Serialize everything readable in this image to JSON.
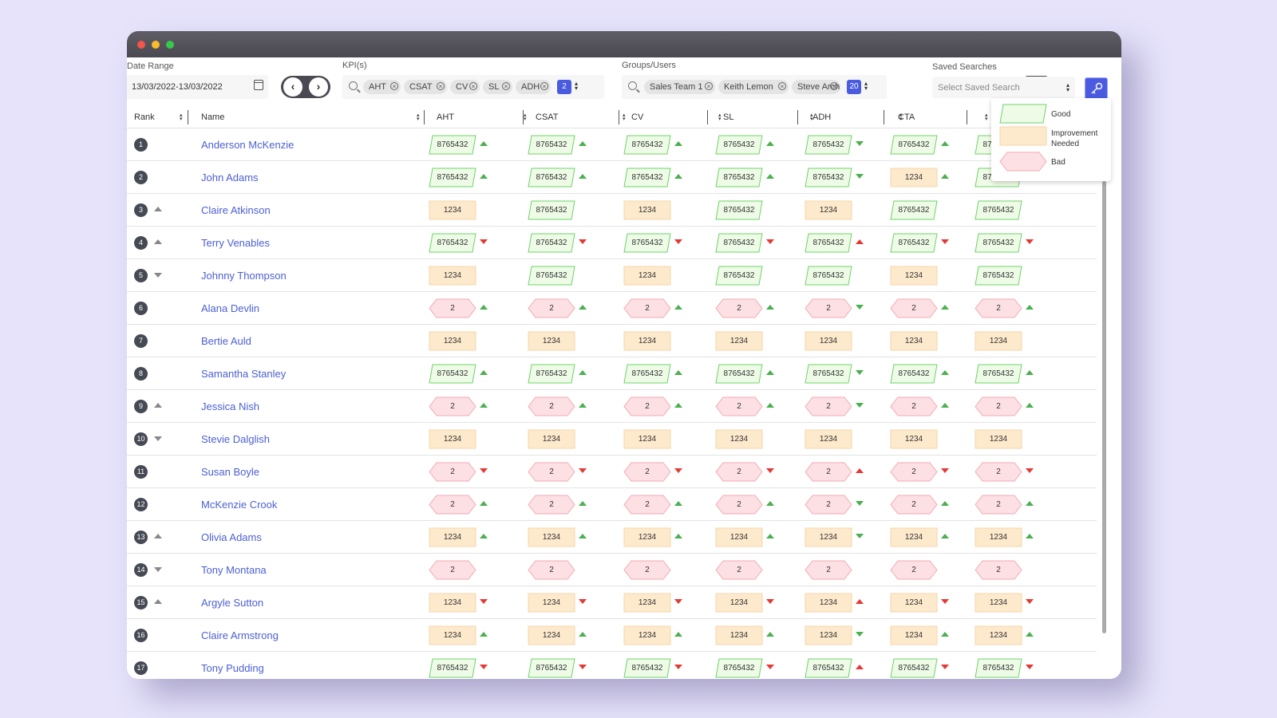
{
  "filters": {
    "date_range": {
      "label": "Date Range",
      "value": "13/03/2022-13/03/2022"
    },
    "kpis": {
      "label": "KPI(s)",
      "chips": [
        "AHT",
        "CSAT",
        "CV",
        "SL",
        "ADH"
      ],
      "count": "2"
    },
    "groups": {
      "label": "Groups/Users",
      "chips": [
        "Sales Team 1",
        "Keith Lemon",
        "Steve Arch"
      ],
      "count": "20"
    },
    "saved": {
      "label": "Saved Searches",
      "placeholder": "Select Saved Search"
    }
  },
  "table": {
    "headers": {
      "rank": "Rank",
      "name": "Name",
      "kpis": [
        "AHT",
        "CSAT",
        "CV",
        "SL",
        "ADH",
        "CTA",
        ""
      ]
    },
    "rows": [
      {
        "rank": "1",
        "rank_trend": "none",
        "name": "Anderson McKenzie",
        "cells": [
          [
            "g",
            "8765432",
            "up"
          ],
          [
            "g",
            "8765432",
            "up"
          ],
          [
            "g",
            "8765432",
            "up"
          ],
          [
            "g",
            "8765432",
            "up"
          ],
          [
            "g",
            "8765432",
            "downg"
          ],
          [
            "g",
            "8765432",
            "up"
          ],
          [
            "g",
            "8765432",
            "none"
          ]
        ]
      },
      {
        "rank": "2",
        "rank_trend": "none",
        "name": "John Adams",
        "cells": [
          [
            "g",
            "8765432",
            "up"
          ],
          [
            "g",
            "8765432",
            "up"
          ],
          [
            "g",
            "8765432",
            "up"
          ],
          [
            "g",
            "8765432",
            "up"
          ],
          [
            "g",
            "8765432",
            "downg"
          ],
          [
            "o",
            "1234",
            "up"
          ],
          [
            "g",
            "8765432",
            "none"
          ]
        ]
      },
      {
        "rank": "3",
        "rank_trend": "up",
        "name": "Claire Atkinson",
        "cells": [
          [
            "o",
            "1234",
            "none"
          ],
          [
            "g",
            "8765432",
            "none"
          ],
          [
            "o",
            "1234",
            "none"
          ],
          [
            "g",
            "8765432",
            "none"
          ],
          [
            "o",
            "1234",
            "none"
          ],
          [
            "g",
            "8765432",
            "none"
          ],
          [
            "g",
            "8765432",
            "none"
          ]
        ]
      },
      {
        "rank": "4",
        "rank_trend": "up",
        "name": "Terry Venables",
        "cells": [
          [
            "g",
            "8765432",
            "down"
          ],
          [
            "g",
            "8765432",
            "down"
          ],
          [
            "g",
            "8765432",
            "down"
          ],
          [
            "g",
            "8765432",
            "down"
          ],
          [
            "g",
            "8765432",
            "upr"
          ],
          [
            "g",
            "8765432",
            "down"
          ],
          [
            "g",
            "8765432",
            "down"
          ]
        ]
      },
      {
        "rank": "5",
        "rank_trend": "down",
        "name": "Johnny Thompson",
        "cells": [
          [
            "o",
            "1234",
            "none"
          ],
          [
            "g",
            "8765432",
            "none"
          ],
          [
            "o",
            "1234",
            "none"
          ],
          [
            "g",
            "8765432",
            "none"
          ],
          [
            "g",
            "8765432",
            "none"
          ],
          [
            "o",
            "1234",
            "none"
          ],
          [
            "g",
            "8765432",
            "none"
          ]
        ]
      },
      {
        "rank": "6",
        "rank_trend": "none",
        "name": "Alana Devlin",
        "cells": [
          [
            "r",
            "2",
            "up"
          ],
          [
            "r",
            "2",
            "up"
          ],
          [
            "r",
            "2",
            "up"
          ],
          [
            "r",
            "2",
            "up"
          ],
          [
            "r",
            "2",
            "downg"
          ],
          [
            "r",
            "2",
            "up"
          ],
          [
            "r",
            "2",
            "up"
          ]
        ]
      },
      {
        "rank": "7",
        "rank_trend": "none",
        "name": "Bertie Auld",
        "cells": [
          [
            "o",
            "1234",
            "none"
          ],
          [
            "o",
            "1234",
            "none"
          ],
          [
            "o",
            "1234",
            "none"
          ],
          [
            "o",
            "1234",
            "none"
          ],
          [
            "o",
            "1234",
            "none"
          ],
          [
            "o",
            "1234",
            "none"
          ],
          [
            "o",
            "1234",
            "none"
          ]
        ]
      },
      {
        "rank": "8",
        "rank_trend": "none",
        "name": "Samantha Stanley",
        "cells": [
          [
            "g",
            "8765432",
            "up"
          ],
          [
            "g",
            "8765432",
            "up"
          ],
          [
            "g",
            "8765432",
            "up"
          ],
          [
            "g",
            "8765432",
            "up"
          ],
          [
            "g",
            "8765432",
            "downg"
          ],
          [
            "g",
            "8765432",
            "up"
          ],
          [
            "g",
            "8765432",
            "up"
          ]
        ]
      },
      {
        "rank": "9",
        "rank_trend": "up",
        "name": "Jessica Nish",
        "cells": [
          [
            "r",
            "2",
            "up"
          ],
          [
            "r",
            "2",
            "up"
          ],
          [
            "r",
            "2",
            "up"
          ],
          [
            "r",
            "2",
            "up"
          ],
          [
            "r",
            "2",
            "downg"
          ],
          [
            "r",
            "2",
            "up"
          ],
          [
            "r",
            "2",
            "up"
          ]
        ]
      },
      {
        "rank": "10",
        "rank_trend": "down",
        "name": "Stevie Dalglish",
        "cells": [
          [
            "o",
            "1234",
            "none"
          ],
          [
            "o",
            "1234",
            "none"
          ],
          [
            "o",
            "1234",
            "none"
          ],
          [
            "o",
            "1234",
            "none"
          ],
          [
            "o",
            "1234",
            "none"
          ],
          [
            "o",
            "1234",
            "none"
          ],
          [
            "o",
            "1234",
            "none"
          ]
        ]
      },
      {
        "rank": "11",
        "rank_trend": "none",
        "name": "Susan Boyle",
        "cells": [
          [
            "r",
            "2",
            "down"
          ],
          [
            "r",
            "2",
            "down"
          ],
          [
            "r",
            "2",
            "down"
          ],
          [
            "r",
            "2",
            "down"
          ],
          [
            "r",
            "2",
            "upr"
          ],
          [
            "r",
            "2",
            "down"
          ],
          [
            "r",
            "2",
            "down"
          ]
        ]
      },
      {
        "rank": "12",
        "rank_trend": "none",
        "name": "McKenzie Crook",
        "cells": [
          [
            "r",
            "2",
            "up"
          ],
          [
            "r",
            "2",
            "up"
          ],
          [
            "r",
            "2",
            "up"
          ],
          [
            "r",
            "2",
            "up"
          ],
          [
            "r",
            "2",
            "downg"
          ],
          [
            "r",
            "2",
            "up"
          ],
          [
            "r",
            "2",
            "up"
          ]
        ]
      },
      {
        "rank": "13",
        "rank_trend": "up",
        "name": "Olivia Adams",
        "cells": [
          [
            "o",
            "1234",
            "up"
          ],
          [
            "o",
            "1234",
            "up"
          ],
          [
            "o",
            "1234",
            "up"
          ],
          [
            "o",
            "1234",
            "up"
          ],
          [
            "o",
            "1234",
            "downg"
          ],
          [
            "o",
            "1234",
            "up"
          ],
          [
            "o",
            "1234",
            "up"
          ]
        ]
      },
      {
        "rank": "14",
        "rank_trend": "down",
        "name": "Tony Montana",
        "cells": [
          [
            "r",
            "2",
            "none"
          ],
          [
            "r",
            "2",
            "none"
          ],
          [
            "r",
            "2",
            "none"
          ],
          [
            "r",
            "2",
            "none"
          ],
          [
            "r",
            "2",
            "none"
          ],
          [
            "r",
            "2",
            "none"
          ],
          [
            "r",
            "2",
            "none"
          ]
        ]
      },
      {
        "rank": "15",
        "rank_trend": "up",
        "name": "Argyle Sutton",
        "cells": [
          [
            "o",
            "1234",
            "down"
          ],
          [
            "o",
            "1234",
            "down"
          ],
          [
            "o",
            "1234",
            "down"
          ],
          [
            "o",
            "1234",
            "down"
          ],
          [
            "o",
            "1234",
            "upr"
          ],
          [
            "o",
            "1234",
            "down"
          ],
          [
            "o",
            "1234",
            "down"
          ]
        ]
      },
      {
        "rank": "16",
        "rank_trend": "none",
        "name": "Claire Armstrong",
        "cells": [
          [
            "o",
            "1234",
            "up"
          ],
          [
            "o",
            "1234",
            "up"
          ],
          [
            "o",
            "1234",
            "up"
          ],
          [
            "o",
            "1234",
            "up"
          ],
          [
            "o",
            "1234",
            "downg"
          ],
          [
            "o",
            "1234",
            "up"
          ],
          [
            "o",
            "1234",
            "up"
          ]
        ]
      },
      {
        "rank": "17",
        "rank_trend": "none",
        "name": "Tony Pudding",
        "cells": [
          [
            "g",
            "8765432",
            "down"
          ],
          [
            "g",
            "8765432",
            "down"
          ],
          [
            "g",
            "8765432",
            "down"
          ],
          [
            "g",
            "8765432",
            "down"
          ],
          [
            "g",
            "8765432",
            "upr"
          ],
          [
            "g",
            "8765432",
            "down"
          ],
          [
            "g",
            "8765432",
            "down"
          ]
        ]
      }
    ]
  },
  "legend": [
    {
      "key": "g",
      "label": "Good"
    },
    {
      "key": "o",
      "label": "Improvement Needed"
    },
    {
      "key": "r",
      "label": "Bad"
    }
  ],
  "colors": {
    "good_fill": "#eefbe6",
    "good_stroke": "#6fd36a",
    "improve_fill": "#fde9cc",
    "improve_stroke": "#f5d6a8",
    "bad_fill": "#fde0e3",
    "bad_stroke": "#f2aab3",
    "link": "#4b5fd4",
    "accent": "#4a5be0",
    "trend_up": "#4caf50",
    "trend_down": "#e53935"
  },
  "icons": {
    "calendar": "calendar-icon",
    "prev": "chevron-left-icon",
    "next": "chevron-right-icon",
    "search": "search-icon",
    "bookmark": "bookmark-icon",
    "key": "key-icon"
  }
}
